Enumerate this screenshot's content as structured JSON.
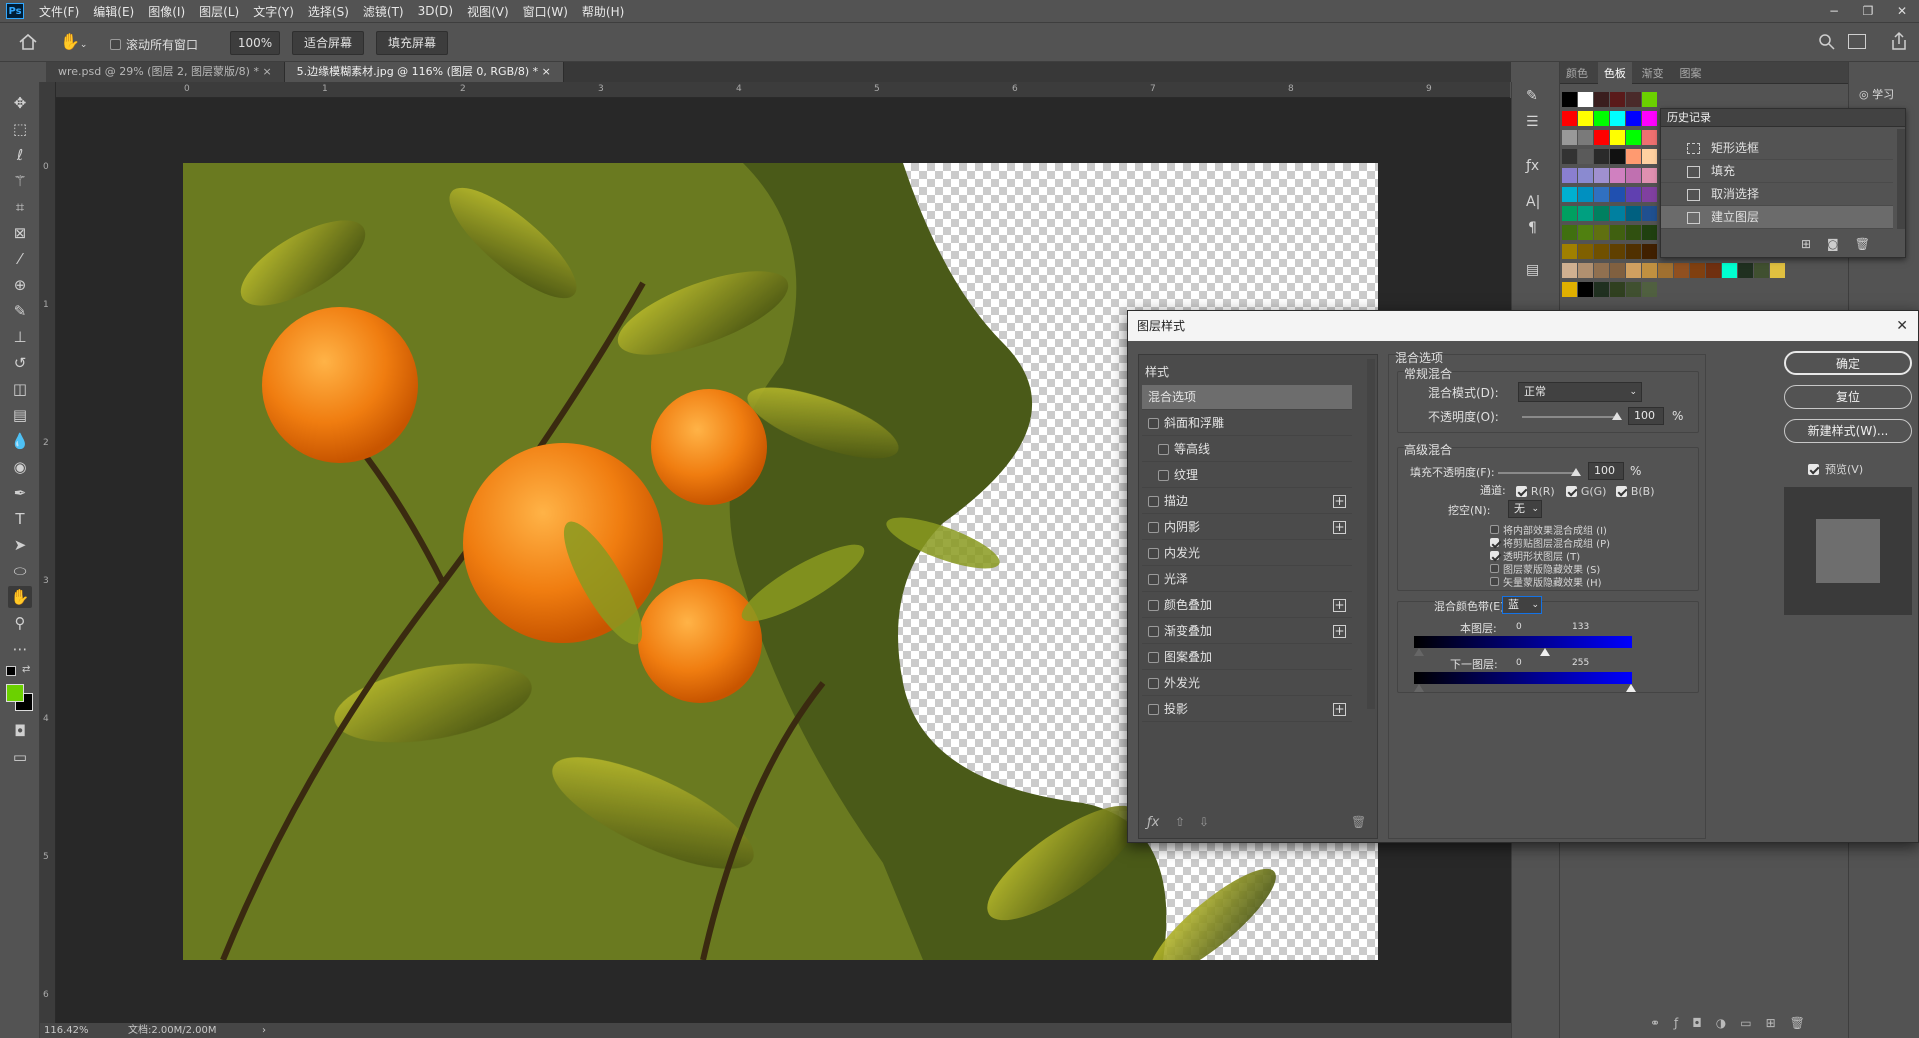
{
  "app": {
    "logo": "Ps"
  },
  "menu": [
    "文件(F)",
    "编辑(E)",
    "图像(I)",
    "图层(L)",
    "文字(Y)",
    "选择(S)",
    "滤镜(T)",
    "3D(D)",
    "视图(V)",
    "窗口(W)",
    "帮助(H)"
  ],
  "window_controls": {
    "minimize": "−",
    "restore": "❐",
    "close": "✕"
  },
  "options": {
    "scroll_all": "滚动所有窗口",
    "zoom_btn": "100%",
    "fit_btn": "适合屏幕",
    "fill_btn": "填充屏幕"
  },
  "tabs": [
    {
      "label": "wre.psd @ 29% (图层 2, 图层蒙版/8) *",
      "close": "×"
    },
    {
      "label": "5.边缘模糊素材.jpg @ 116% (图层 0, RGB/8) *",
      "close": "×"
    }
  ],
  "ruler": {
    "h": [
      "0",
      "1",
      "2",
      "3",
      "4",
      "5",
      "6",
      "7",
      "8",
      "9"
    ],
    "v": [
      "0",
      "1",
      "2",
      "3",
      "4",
      "5",
      "6"
    ]
  },
  "status": {
    "zoom": "116.42%",
    "doc": "文档:2.00M/2.00M"
  },
  "panels": {
    "tabs": [
      "颜色",
      "色板",
      "渐变",
      "图案"
    ],
    "active": "色板",
    "learn": "学习"
  },
  "swatches": {
    "row1": [
      "#000000",
      "#ffffff",
      "#3a1e1e",
      "#5a1a1a",
      "#4a2a2a",
      "#6bd100"
    ],
    "row2": [
      "#ff0000",
      "#ffff00",
      "#00ff00",
      "#00ffff",
      "#0000ff",
      "#ff00ff"
    ],
    "row3": [
      "#999999",
      "#7a7a7a",
      "#ff0000",
      "#ffff00",
      "#00ff00",
      "#ee7070"
    ],
    "row4": [
      "#333333",
      "#5a5a5a",
      "#2a2a2a",
      "#111111",
      "#ff9a70",
      "#ffd0a0"
    ],
    "row5": [
      "#8a7fd0",
      "#8a8ad0",
      "#a090d0",
      "#d080c0",
      "#c070b0",
      "#e090b0"
    ],
    "row6": [
      "#00b0d0",
      "#0090c0",
      "#3070c0",
      "#2050b0",
      "#6040b0",
      "#8040a0"
    ],
    "row7": [
      "#00a060",
      "#00a080",
      "#008060",
      "#0080a0",
      "#006080",
      "#205090"
    ],
    "row8": [
      "#407010",
      "#508010",
      "#607010",
      "#406010",
      "#305010",
      "#204010"
    ],
    "row9": [
      "#a08000",
      "#806000",
      "#705000",
      "#604000",
      "#503000",
      "#402000"
    ],
    "row10": [
      "#d0b090",
      "#b09070",
      "#907050",
      "#806040",
      "#d0a060",
      "#c09040",
      "#a07030",
      "#905020",
      "#804010",
      "#703010",
      "#00ffd0",
      "#203020",
      "#405030",
      "#e0c040"
    ],
    "row11": [
      "#e0b000",
      "#000000",
      "#203020",
      "#304020",
      "#405030",
      "#506040"
    ]
  },
  "history": {
    "title": "历史记录",
    "items": [
      {
        "label": "矩形选框",
        "icon": "marquee-icon"
      },
      {
        "label": "填充",
        "icon": "doc-icon"
      },
      {
        "label": "取消选择",
        "icon": "doc-icon"
      },
      {
        "label": "建立图层",
        "icon": "doc-icon"
      }
    ]
  },
  "dialog": {
    "title": "图层样式",
    "close": "✕",
    "styles_header": "样式",
    "styles": [
      {
        "label": "混合选项",
        "check": false,
        "plus": false,
        "indent": false,
        "active": true
      },
      {
        "label": "斜面和浮雕",
        "check": true,
        "plus": false,
        "indent": false
      },
      {
        "label": "等高线",
        "check": true,
        "plus": false,
        "indent": true
      },
      {
        "label": "纹理",
        "check": true,
        "plus": false,
        "indent": true
      },
      {
        "label": "描边",
        "check": true,
        "plus": true,
        "indent": false
      },
      {
        "label": "内阴影",
        "check": true,
        "plus": true,
        "indent": false
      },
      {
        "label": "内发光",
        "check": true,
        "plus": false,
        "indent": false
      },
      {
        "label": "光泽",
        "check": true,
        "plus": false,
        "indent": false
      },
      {
        "label": "颜色叠加",
        "check": true,
        "plus": true,
        "indent": false
      },
      {
        "label": "渐变叠加",
        "check": true,
        "plus": true,
        "indent": false
      },
      {
        "label": "图案叠加",
        "check": true,
        "plus": false,
        "indent": false
      },
      {
        "label": "外发光",
        "check": true,
        "plus": false,
        "indent": false
      },
      {
        "label": "投影",
        "check": true,
        "plus": true,
        "indent": false
      }
    ],
    "blend": {
      "section": "混合选项",
      "general": "常规混合",
      "mode_label": "混合模式(D):",
      "mode_value": "正常",
      "opacity_label": "不透明度(O):",
      "opacity_value": "100",
      "pct": "%",
      "advanced": "高级混合",
      "fill_label": "填充不透明度(F):",
      "fill_value": "100",
      "channels_label": "通道:",
      "ch_r": "R(R)",
      "ch_g": "G(G)",
      "ch_b": "B(B)",
      "knockout_label": "挖空(N):",
      "knockout_value": "无",
      "opts": [
        {
          "label": "将内部效果混合成组 (I)",
          "checked": false
        },
        {
          "label": "将剪贴图层混合成组 (P)",
          "checked": true
        },
        {
          "label": "透明形状图层 (T)",
          "checked": true
        },
        {
          "label": "图层蒙版隐藏效果 (S)",
          "checked": false
        },
        {
          "label": "矢量蒙版隐藏效果 (H)",
          "checked": false
        }
      ],
      "blendif_label": "混合颜色带(E):",
      "blendif_value": "蓝",
      "this_layer": "本图层:",
      "this_min": "0",
      "this_max": "133",
      "this_max_fraction": 0.6,
      "under_layer": "下一图层:",
      "under_min": "0",
      "under_max": "255"
    },
    "buttons": {
      "ok": "确定",
      "reset": "复位",
      "new_style": "新建样式(W)...",
      "preview": "预览(V)"
    }
  },
  "colors": {
    "fg": "#6bd100",
    "bg": "#000000",
    "accent": "#1473e6"
  }
}
